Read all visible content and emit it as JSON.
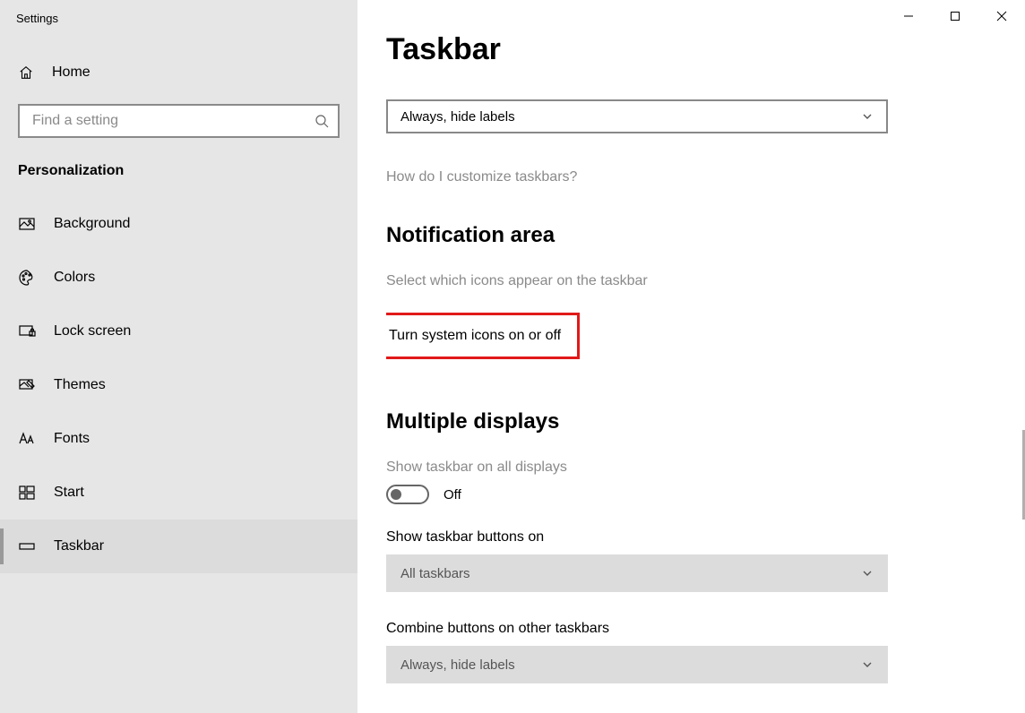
{
  "window": {
    "title": "Settings"
  },
  "sidebar": {
    "home_label": "Home",
    "search_placeholder": "Find a setting",
    "section_label": "Personalization",
    "items": [
      {
        "label": "Background"
      },
      {
        "label": "Colors"
      },
      {
        "label": "Lock screen"
      },
      {
        "label": "Themes"
      },
      {
        "label": "Fonts"
      },
      {
        "label": "Start"
      },
      {
        "label": "Taskbar"
      }
    ]
  },
  "main": {
    "title": "Taskbar",
    "combine_dropdown": "Always, hide labels",
    "help_link": "How do I customize taskbars?",
    "notification": {
      "heading": "Notification area",
      "link_select_icons": "Select which icons appear on the taskbar",
      "link_system_icons": "Turn system icons on or off"
    },
    "multiple_displays": {
      "heading": "Multiple displays",
      "show_all_label": "Show taskbar on all displays",
      "toggle_state": "Off",
      "show_buttons_label": "Show taskbar buttons on",
      "show_buttons_value": "All taskbars",
      "combine_other_label": "Combine buttons on other taskbars",
      "combine_other_value": "Always, hide labels"
    }
  }
}
